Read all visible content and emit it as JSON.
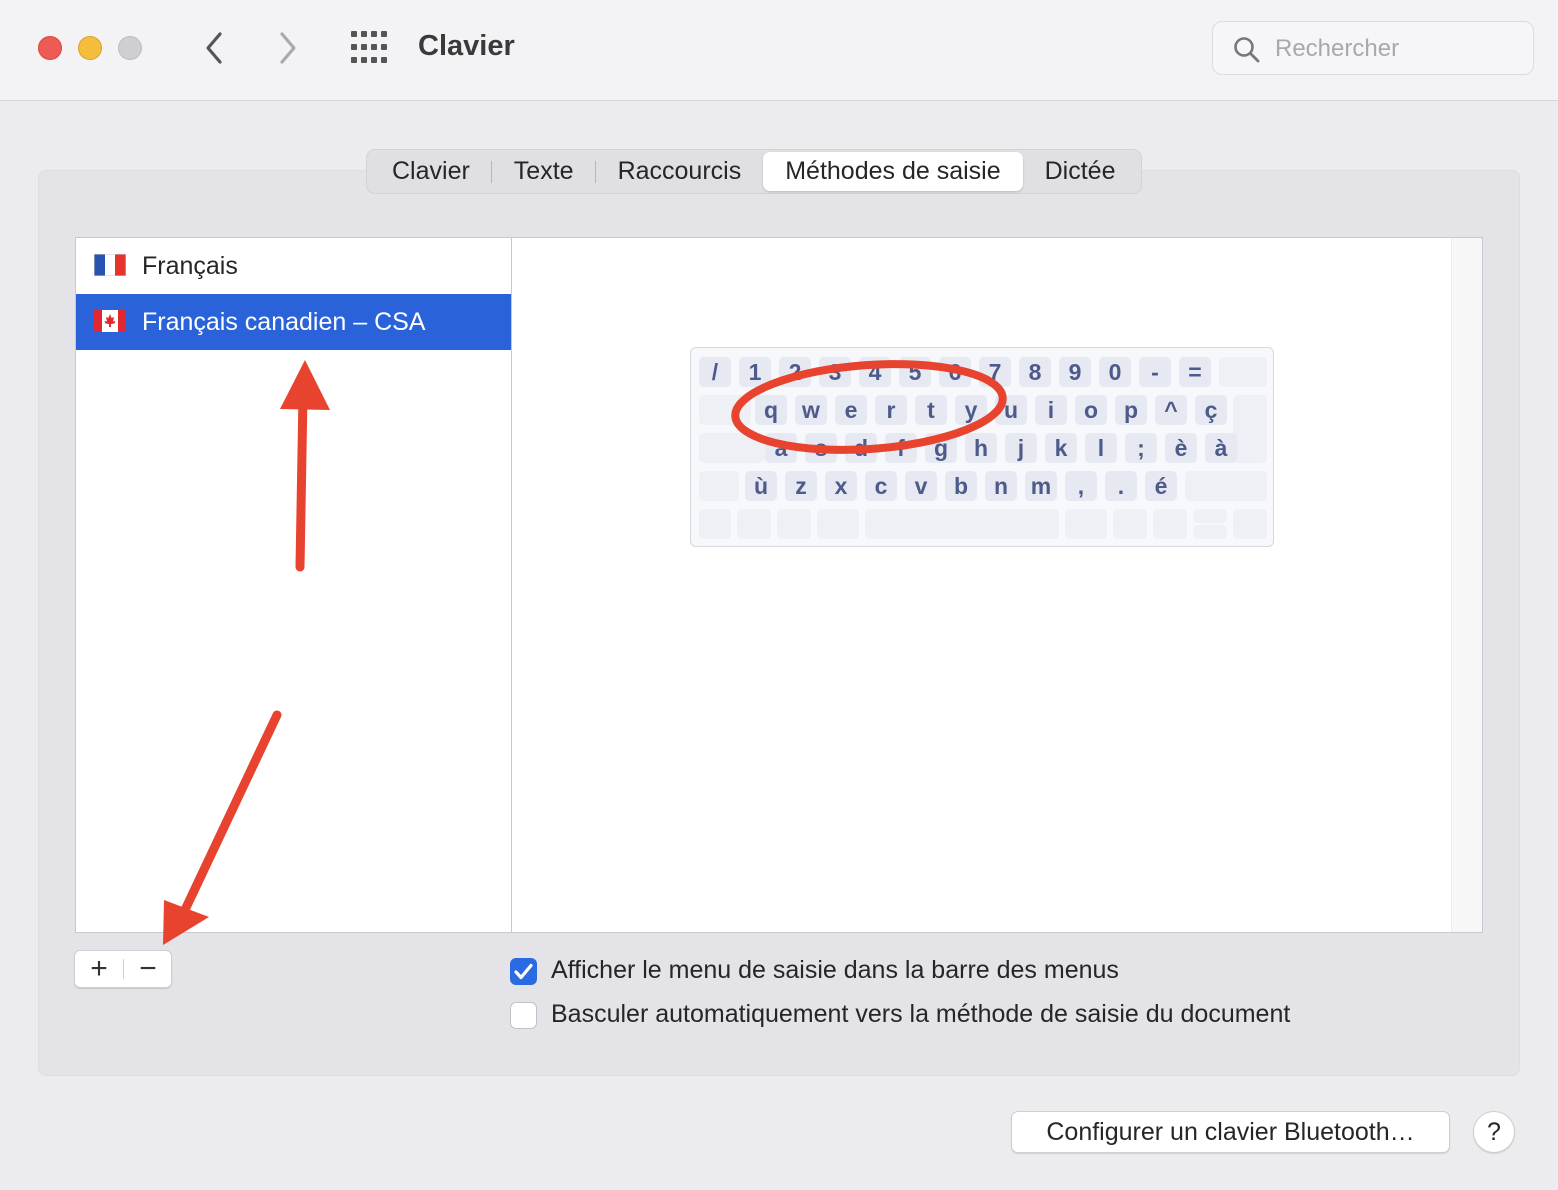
{
  "window": {
    "title": "Clavier"
  },
  "search": {
    "placeholder": "Rechercher",
    "value": ""
  },
  "tabs": [
    {
      "label": "Clavier",
      "active": false
    },
    {
      "label": "Texte",
      "active": false
    },
    {
      "label": "Raccourcis",
      "active": false
    },
    {
      "label": "Méthodes de saisie",
      "active": true
    },
    {
      "label": "Dictée",
      "active": false
    }
  ],
  "input_sources": [
    {
      "label": "Français",
      "flag": "france-flag-icon",
      "selected": false
    },
    {
      "label": "Français canadien – CSA",
      "flag": "canada-flag-icon",
      "selected": true
    }
  ],
  "keyboard_rows": [
    [
      "/",
      "1",
      "2",
      "3",
      "4",
      "5",
      "6",
      "7",
      "8",
      "9",
      "0",
      "-",
      "="
    ],
    [
      "q",
      "w",
      "e",
      "r",
      "t",
      "y",
      "u",
      "i",
      "o",
      "p",
      "^",
      "ç"
    ],
    [
      "a",
      "s",
      "d",
      "f",
      "g",
      "h",
      "j",
      "k",
      "l",
      ";",
      "è",
      "à"
    ],
    [
      "ù",
      "z",
      "x",
      "c",
      "v",
      "b",
      "n",
      "m",
      ",",
      ".",
      "é"
    ]
  ],
  "list_controls": {
    "add": "+",
    "remove": "−"
  },
  "options": {
    "show_menu": {
      "label": "Afficher le menu de saisie dans la barre des menus",
      "checked": true
    },
    "auto_switch": {
      "label": "Basculer automatiquement vers la méthode de saisie du document",
      "checked": false
    }
  },
  "footer": {
    "bluetooth_button": "Configurer un clavier Bluetooth…",
    "help_button": "?"
  },
  "colors": {
    "selection": "#2a63d9",
    "annotation": "#e8432e",
    "checkbox": "#2a6ae3"
  }
}
